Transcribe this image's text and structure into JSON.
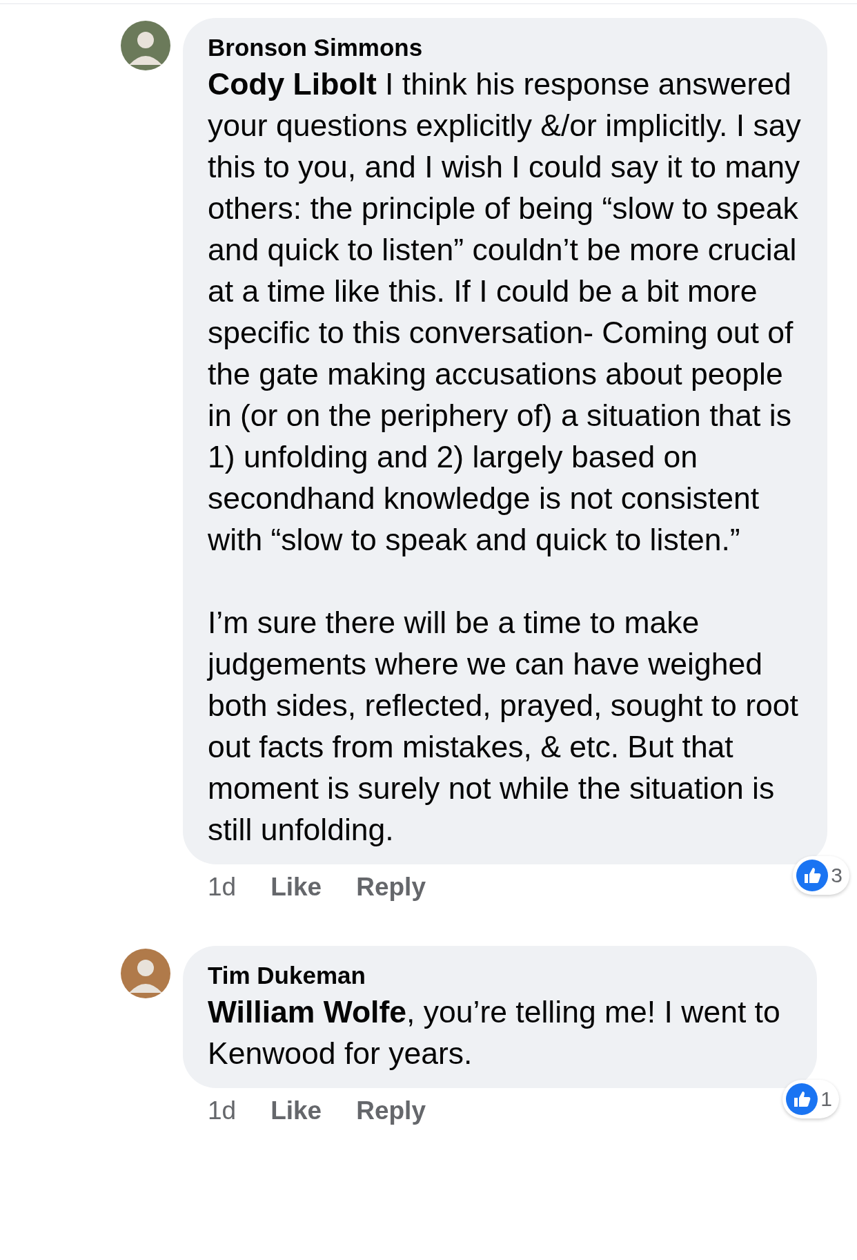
{
  "comments": [
    {
      "author": "Bronson Simmons",
      "paragraphs": [
        "**Cody Libolt** I think his response answered your questions explicitly &/or implicitly. I say this to you, and I wish I could say it to many others: the principle of being “slow to speak and quick to listen” couldn’t be more crucial at a time like this. If I could be a bit more specific to this conversation- Coming out of the gate making accusations about people in (or on the periphery of) a situation that is 1) unfolding and 2) largely based on secondhand knowledge is not consistent with “slow to speak and quick to listen.”",
        "I’m sure there will be a time to make judgements where we can have weighed both sides, reflected, prayed, sought to root out facts from mistakes, & etc. But that moment is surely not while the situation is still unfolding."
      ],
      "time": "1d",
      "actions": [
        "Like",
        "Reply"
      ],
      "reactions": "3"
    },
    {
      "author": "Tim Dukeman",
      "paragraphs": [
        "**William Wolfe**, you’re telling me! I went to Kenwood for years."
      ],
      "time": "1d",
      "actions": [
        "Like",
        "Reply"
      ],
      "reactions": "1"
    }
  ]
}
